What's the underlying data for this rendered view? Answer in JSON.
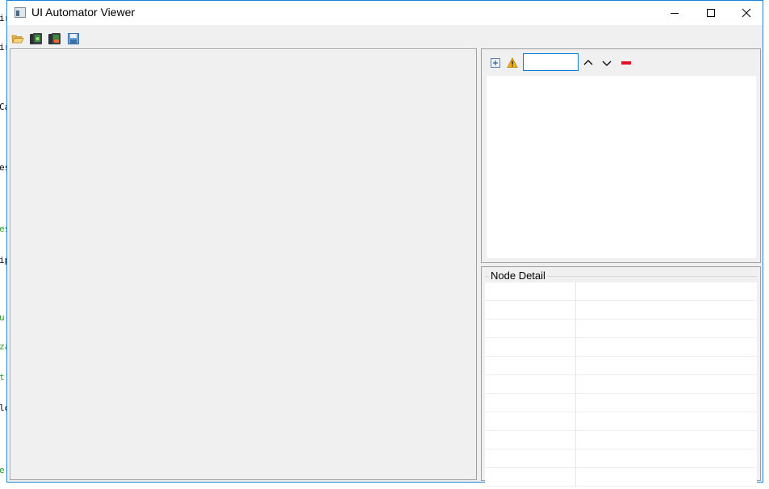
{
  "background_fragments": [
    {
      "text": "ir",
      "color": "#000000"
    },
    {
      "text": "ir",
      "color": "#000000"
    },
    {
      "text": "Ca",
      "color": "#000000"
    },
    {
      "text": "es",
      "color": "#000000"
    },
    {
      "text": "es",
      "color": "#2a9a2a"
    },
    {
      "text": "ip",
      "color": "#000000"
    },
    {
      "text": "u",
      "color": "#2a9a2a"
    },
    {
      "text": "za",
      "color": "#2a9a2a"
    },
    {
      "text": "t",
      "color": "#2a9a2a"
    },
    {
      "text": "lo",
      "color": "#000000"
    },
    {
      "text": "e",
      "color": "#2a9a2a"
    }
  ],
  "window": {
    "title": "UI Automator Viewer",
    "accent_color": "#1883d7"
  },
  "toolbar": {
    "buttons": [
      {
        "name": "open",
        "icon": "folder-open-icon"
      },
      {
        "name": "device-screenshot",
        "icon": "device-screenshot-icon"
      },
      {
        "name": "device-screenshot-compressed",
        "icon": "device-screenshot-compressed-icon"
      },
      {
        "name": "save",
        "icon": "save-icon"
      }
    ]
  },
  "hierarchy": {
    "expand_icon": "expand-all-icon",
    "warning_icon": "warning-icon",
    "search_value": "",
    "prev_icon": "chevron-up-icon",
    "next_icon": "chevron-down-icon",
    "clear_icon": "clear-icon",
    "clear_color": "#e81123"
  },
  "node_detail": {
    "title": "Node Detail",
    "rows": [
      {
        "key": "",
        "value": ""
      },
      {
        "key": "",
        "value": ""
      },
      {
        "key": "",
        "value": ""
      },
      {
        "key": "",
        "value": ""
      },
      {
        "key": "",
        "value": ""
      },
      {
        "key": "",
        "value": ""
      },
      {
        "key": "",
        "value": ""
      },
      {
        "key": "",
        "value": ""
      },
      {
        "key": "",
        "value": ""
      },
      {
        "key": "",
        "value": ""
      },
      {
        "key": "",
        "value": ""
      }
    ]
  }
}
